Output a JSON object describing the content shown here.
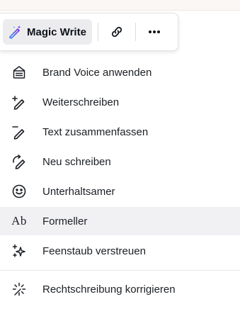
{
  "toolbar": {
    "magic_write_label": "Magic Write",
    "magic_write_icon": "magic-pen-icon",
    "link_icon": "link-icon",
    "more_icon": "more-horizontal-icon"
  },
  "menu": {
    "items": [
      {
        "label": "Brand Voice anwenden",
        "icon": "brand-voice-icon"
      },
      {
        "label": "Weiterschreiben",
        "icon": "continue-writing-icon"
      },
      {
        "label": "Text zusammenfassen",
        "icon": "summarize-icon"
      },
      {
        "label": "Neu schreiben",
        "icon": "rewrite-icon"
      },
      {
        "label": "Unterhaltsamer",
        "icon": "smiley-icon"
      },
      {
        "label": "Formeller",
        "icon": "ab-icon",
        "glyph": "Ab",
        "selected": true
      },
      {
        "label": "Feenstaub verstreuen",
        "icon": "sparkles-icon"
      },
      {
        "label": "Rechtschreibung korrigieren",
        "icon": "spellcheck-icon"
      }
    ]
  },
  "colors": {
    "text": "#0e1318",
    "selected_bg": "#f1f1f4",
    "button_bg": "#ececef",
    "accent_purple": "#7d2ae8",
    "accent_blue": "#3aa0f3"
  }
}
